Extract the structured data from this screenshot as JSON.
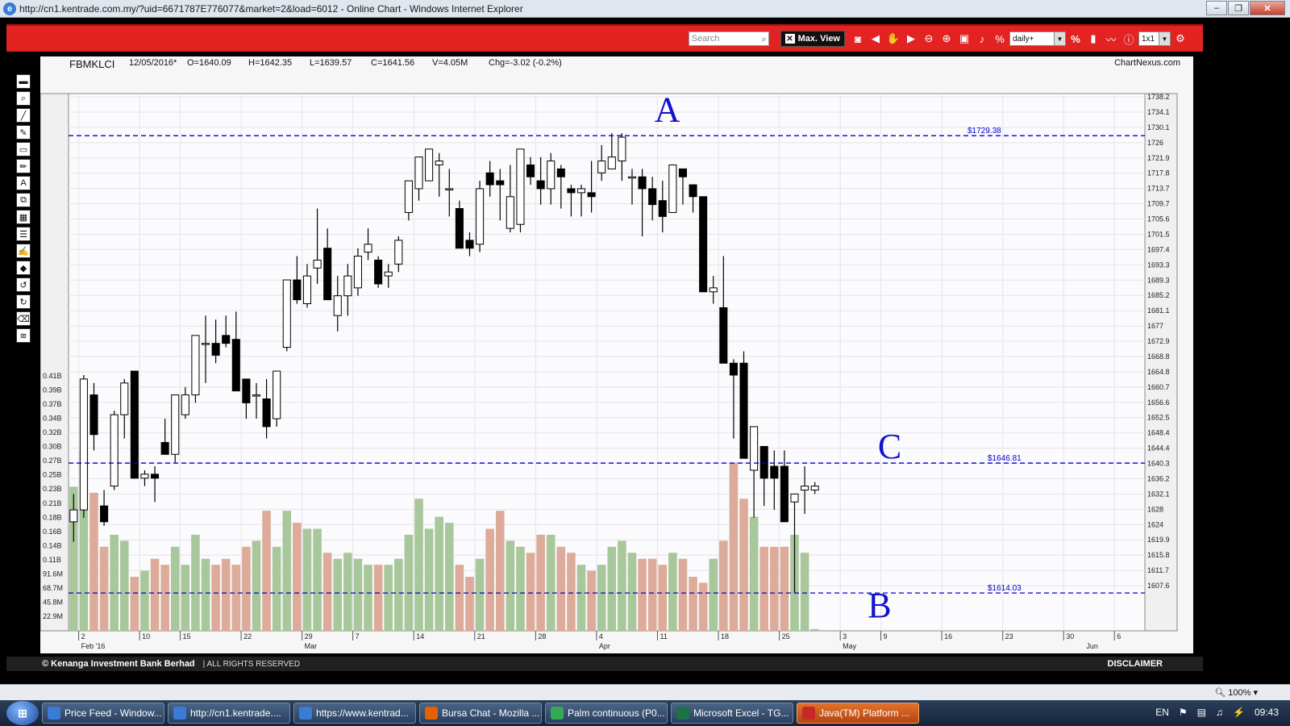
{
  "window": {
    "title": "http://cn1.kentrade.com.my/?uid=6671787E776077&market=2&load=6012 - Online Chart - Windows Internet Explorer"
  },
  "toolbar": {
    "search_placeholder": "Search",
    "maxview_label": "Max. View",
    "interval": "daily+",
    "layout": "1x1"
  },
  "chart_info": {
    "symbol": "FBMKLCI",
    "date": "12/05/2016*",
    "open": "O=1640.09",
    "high": "H=1642.35",
    "low": "L=1639.57",
    "close": "C=1641.56",
    "volume": "V=4.05M",
    "change": "Chg=-3.02 (-0.2%)",
    "brand": "ChartNexus.com"
  },
  "chart_data": {
    "type": "candlestick",
    "price_axis_ticks": [
      "1738.2",
      "1734.1",
      "1730.1",
      "1726",
      "1721.9",
      "1717.8",
      "1713.7",
      "1709.7",
      "1705.6",
      "1701.5",
      "1697.4",
      "1693.3",
      "1689.3",
      "1685.2",
      "1681.1",
      "1677",
      "1672.9",
      "1668.8",
      "1664.8",
      "1660.7",
      "1656.6",
      "1652.5",
      "1648.4",
      "1644.4",
      "1640.3",
      "1636.2",
      "1632.1",
      "1628",
      "1624",
      "1619.9",
      "1615.8",
      "1611.7",
      "1607.6"
    ],
    "volume_axis_ticks": [
      "0.41B",
      "0.39B",
      "0.37B",
      "0.34B",
      "0.32B",
      "0.30B",
      "0.27B",
      "0.25B",
      "0.23B",
      "0.21B",
      "0.18B",
      "0.16B",
      "0.14B",
      "0.11B",
      "91.6M",
      "68.7M",
      "45.8M",
      "22.9M"
    ],
    "x_ticks": [
      "2",
      "10",
      "15",
      "22",
      "29",
      "7",
      "14",
      "21",
      "28",
      "4",
      "11",
      "18",
      "25",
      "3",
      "9",
      "16",
      "23",
      "30",
      "6"
    ],
    "x_tick_index": [
      1,
      7,
      11,
      17,
      23,
      28,
      34,
      40,
      46,
      52,
      58,
      64,
      70,
      76,
      80,
      86,
      92,
      98,
      103
    ],
    "month_labels": [
      {
        "label": "Feb '16",
        "index": 1
      },
      {
        "label": "Mar",
        "index": 23
      },
      {
        "label": "Apr",
        "index": 52
      },
      {
        "label": "May",
        "index": 76
      },
      {
        "label": "Jun",
        "index": 100
      }
    ],
    "x_slots": 106,
    "price_range": [
      1604.5,
      1740
    ],
    "volume_max": 0.43,
    "candles": [
      [
        1632,
        1639,
        1627,
        1635,
        0.24
      ],
      [
        1635,
        1669,
        1633,
        1668,
        0.3
      ],
      [
        1664,
        1667,
        1650,
        1654,
        0.23
      ],
      [
        1636,
        1640,
        1631,
        1632,
        0.14
      ],
      [
        1641,
        1660,
        1640,
        1659,
        0.16
      ],
      [
        1659,
        1668,
        1653,
        1667,
        0.15
      ],
      [
        1670,
        1670,
        1643,
        1643,
        0.09
      ],
      [
        1643,
        1645,
        1641,
        1644,
        0.1
      ],
      [
        1644,
        1646,
        1637,
        1643,
        0.12
      ],
      [
        1652,
        1658,
        1649,
        1649,
        0.11
      ],
      [
        1649,
        1664,
        1647,
        1664,
        0.14
      ],
      [
        1659,
        1666,
        1658,
        1664,
        0.11
      ],
      [
        1664,
        1679,
        1662,
        1679,
        0.16
      ],
      [
        1677,
        1684,
        1667,
        1677,
        0.12
      ],
      [
        1677,
        1683,
        1672,
        1674,
        0.11
      ],
      [
        1679,
        1684,
        1676,
        1677,
        0.12
      ],
      [
        1678,
        1685,
        1665,
        1665,
        0.11
      ],
      [
        1668,
        1668,
        1658,
        1662,
        0.14
      ],
      [
        1664,
        1667,
        1658,
        1664,
        0.15
      ],
      [
        1663,
        1668,
        1653,
        1656,
        0.2
      ],
      [
        1658,
        1670,
        1656,
        1670,
        0.14
      ],
      [
        1676,
        1693,
        1675,
        1693,
        0.2
      ],
      [
        1693,
        1699,
        1687,
        1688,
        0.18
      ],
      [
        1687,
        1697,
        1686,
        1694,
        0.17
      ],
      [
        1696,
        1711,
        1692,
        1698,
        0.17
      ],
      [
        1701,
        1706,
        1688,
        1688,
        0.13
      ],
      [
        1684,
        1694,
        1680,
        1689,
        0.12
      ],
      [
        1689,
        1697,
        1684,
        1694,
        0.13
      ],
      [
        1691,
        1701,
        1689,
        1699,
        0.12
      ],
      [
        1700,
        1706,
        1698,
        1702,
        0.11
      ],
      [
        1698,
        1699,
        1691,
        1692,
        0.11
      ],
      [
        1694,
        1697,
        1691,
        1695,
        0.11
      ],
      [
        1697,
        1704,
        1695,
        1703,
        0.12
      ],
      [
        1710,
        1718,
        1708,
        1718,
        0.16
      ],
      [
        1716,
        1723,
        1713,
        1724,
        0.22
      ],
      [
        1718,
        1726,
        1718,
        1726,
        0.17
      ],
      [
        1722,
        1725,
        1714,
        1723,
        0.19
      ],
      [
        1716,
        1721,
        1709,
        1716,
        0.18
      ],
      [
        1711,
        1713,
        1701,
        1701,
        0.11
      ],
      [
        1703,
        1705,
        1699,
        1701,
        0.09
      ],
      [
        1702,
        1718,
        1700,
        1716,
        0.12
      ],
      [
        1720,
        1723,
        1714,
        1717,
        0.17
      ],
      [
        1718,
        1721,
        1708,
        1717,
        0.2
      ],
      [
        1706,
        1722,
        1705,
        1714,
        0.15
      ],
      [
        1707,
        1726,
        1705,
        1726,
        0.14
      ],
      [
        1722,
        1724,
        1717,
        1719,
        0.13
      ],
      [
        1718,
        1724,
        1712,
        1716,
        0.16
      ],
      [
        1716,
        1725,
        1712,
        1723,
        0.16
      ],
      [
        1721,
        1722,
        1711,
        1719,
        0.14
      ],
      [
        1716,
        1717,
        1709,
        1715,
        0.13
      ],
      [
        1715,
        1717,
        1709,
        1716,
        0.11
      ],
      [
        1715,
        1723,
        1710,
        1714,
        0.1
      ],
      [
        1720,
        1727,
        1718,
        1723,
        0.11
      ],
      [
        1721,
        1730,
        1721,
        1724,
        0.14
      ],
      [
        1723,
        1730,
        1718,
        1729,
        0.15
      ],
      [
        1719,
        1721,
        1712,
        1719,
        0.13
      ],
      [
        1719,
        1721,
        1704,
        1716,
        0.12
      ],
      [
        1716,
        1719,
        1708,
        1712,
        0.12
      ],
      [
        1713,
        1718,
        1705,
        1709,
        0.11
      ],
      [
        1710,
        1722,
        1710,
        1722,
        0.13
      ],
      [
        1721,
        1720,
        1712,
        1719,
        0.12
      ],
      [
        1717,
        1716,
        1710,
        1714,
        0.09
      ],
      [
        1714,
        1714,
        1690,
        1690,
        0.08
      ],
      [
        1690,
        1694,
        1687,
        1691,
        0.12
      ],
      [
        1686,
        1699,
        1672,
        1672,
        0.15
      ],
      [
        1672,
        1673,
        1653,
        1669,
        0.28
      ],
      [
        1672,
        1675,
        1649,
        1648,
        0.22
      ],
      [
        1645,
        1656,
        1633,
        1656,
        0.19
      ],
      [
        1651,
        1651,
        1636,
        1643,
        0.14
      ],
      [
        1646,
        1650,
        1635,
        1643,
        0.14
      ],
      [
        1646,
        1650,
        1634,
        1632,
        0.14
      ],
      [
        1637,
        1639,
        1614,
        1639,
        0.16
      ],
      [
        1640,
        1646,
        1634,
        1641,
        0.13
      ],
      [
        1640,
        1642,
        1639,
        1641,
        0.003
      ]
    ],
    "levels": [
      {
        "label": "$1729.38",
        "value": 1729.38
      },
      {
        "label": "$1646.81",
        "value": 1646.81
      },
      {
        "label": "$1614.03",
        "value": 1614.03
      }
    ],
    "annotations": [
      {
        "label": "A",
        "index": 58,
        "price": 1733
      },
      {
        "label": "C",
        "index": 80,
        "price": 1648
      },
      {
        "label": "B",
        "index": 79,
        "price": 1608
      }
    ],
    "up_color": "#ffffff",
    "down_color": "#000000",
    "vol_up_color": "#a8c79b",
    "vol_down_color": "#ddab99",
    "level_color": "#0000cc",
    "annotation_color": "#1111cc"
  },
  "footer": {
    "copyright": "© Kenanga Investment Bank Berhad",
    "rights": "| ALL RIGHTS RESERVED",
    "disclaimer": "DISCLAIMER"
  },
  "statusbar": {
    "zoom": "100%"
  },
  "taskbar": {
    "items": [
      {
        "label": "Price Feed - Window...",
        "icon": "ie-icon",
        "color": "#3a7bd5"
      },
      {
        "label": "http://cn1.kentrade....",
        "icon": "ie-icon",
        "color": "#3a7bd5"
      },
      {
        "label": "https://www.kentrad...",
        "icon": "ie-icon",
        "color": "#3a7bd5"
      },
      {
        "label": "Bursa Chat - Mozilla ...",
        "icon": "firefox-icon",
        "color": "#e66000"
      },
      {
        "label": "Palm continuous (P0...",
        "icon": "chrome-icon",
        "color": "#34a853"
      },
      {
        "label": "Microsoft Excel - TG...",
        "icon": "excel-icon",
        "color": "#1e7145"
      },
      {
        "label": "Java(TM) Platform ...",
        "icon": "java-icon",
        "color": "#c62828"
      }
    ],
    "lang": "EN",
    "time": "09:43"
  }
}
